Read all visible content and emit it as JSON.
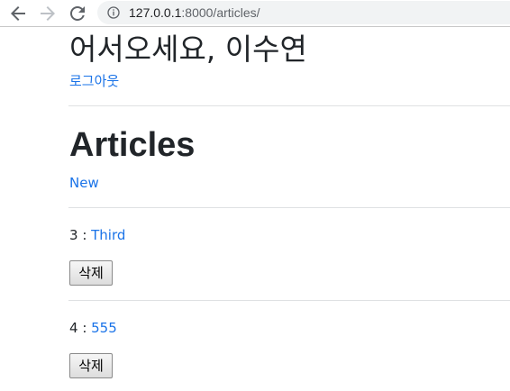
{
  "browser": {
    "url_host": "127.0.0.1",
    "url_rest": ":8000/articles/",
    "icons": [
      "back-arrow-icon",
      "forward-arrow-icon",
      "reload-icon",
      "info-icon"
    ]
  },
  "header": {
    "greeting": "어서오세요, 이수연",
    "logout_label": "로그아웃"
  },
  "main": {
    "title": "Articles",
    "new_label": "New",
    "articles": [
      {
        "id": "3",
        "sep": " : ",
        "title": "Third",
        "delete_label": "삭제"
      },
      {
        "id": "4",
        "sep": " : ",
        "title": "555",
        "delete_label": "삭제"
      }
    ]
  },
  "colors": {
    "link": "#1a73e8",
    "text": "#212529",
    "divider": "#dfe1e3",
    "omnibox_bg": "#f1f3f4"
  }
}
